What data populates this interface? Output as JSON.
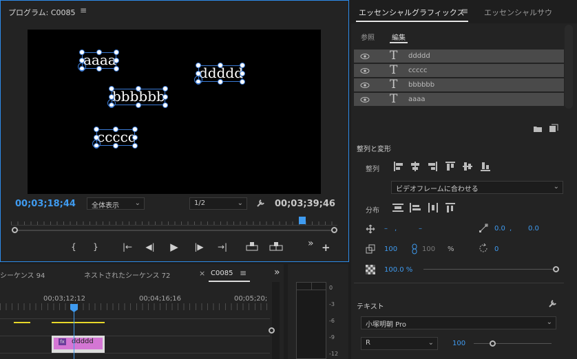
{
  "program": {
    "title": "プログラム: C0085",
    "menu_icon": "≡",
    "texts": [
      "aaaa",
      "ddddd",
      "bbbbbb",
      "ccccc"
    ],
    "timecode_current": "00;03;18;44",
    "zoom": "全体表示",
    "resolution": "1/2",
    "timecode_duration": "00;03;39;46",
    "colors": {
      "accent": "#3f9bf0",
      "selection": "#3b7bd6"
    }
  },
  "controls": {
    "mark_in": "{",
    "mark_out": "}",
    "go_in": "|←",
    "step_back": "◀|",
    "play": "▶",
    "step_fwd": "|▶",
    "go_out": "→|",
    "more": "»",
    "add": "+"
  },
  "essential_graphics": {
    "tab": "エッセンシャルグラフィックス",
    "tab_menu": "≡",
    "tab2": "エッセンシャルサウ",
    "browse": "参照",
    "edit": "編集",
    "layers": [
      "ddddd",
      "ccccc",
      "bbbbbb",
      "aaaa"
    ],
    "align_transform": "整列と変形",
    "align": "整列",
    "align_to": "ビデオフレームに合わせる",
    "distribute": "分布",
    "pos_x": "–",
    "pos_sep": ",",
    "pos_y": "–",
    "anchor_x": "0.0",
    "anchor_sep": ",",
    "anchor_y": "0.0",
    "scale": "100",
    "scale_linked": "100",
    "scale_unit": "%",
    "rotation": "0",
    "opacity": "100.0 %",
    "text_section": "テキスト",
    "font": "小塚明朝 Pro",
    "font_style": "R",
    "font_size": "100"
  },
  "timeline": {
    "tabs": [
      "シーケンス 94",
      "ネストされたシーケンス 72",
      "C0085"
    ],
    "close": "×",
    "menu": "≡",
    "more": "»",
    "ruler": [
      "00;03;12;12",
      "00;04;16;16",
      "00;05;20;"
    ],
    "clip_fx": "fx",
    "clip_name": "ddddd"
  },
  "meter": {
    "ticks": [
      "0",
      "-3",
      "-6",
      "-9",
      "-12"
    ]
  }
}
